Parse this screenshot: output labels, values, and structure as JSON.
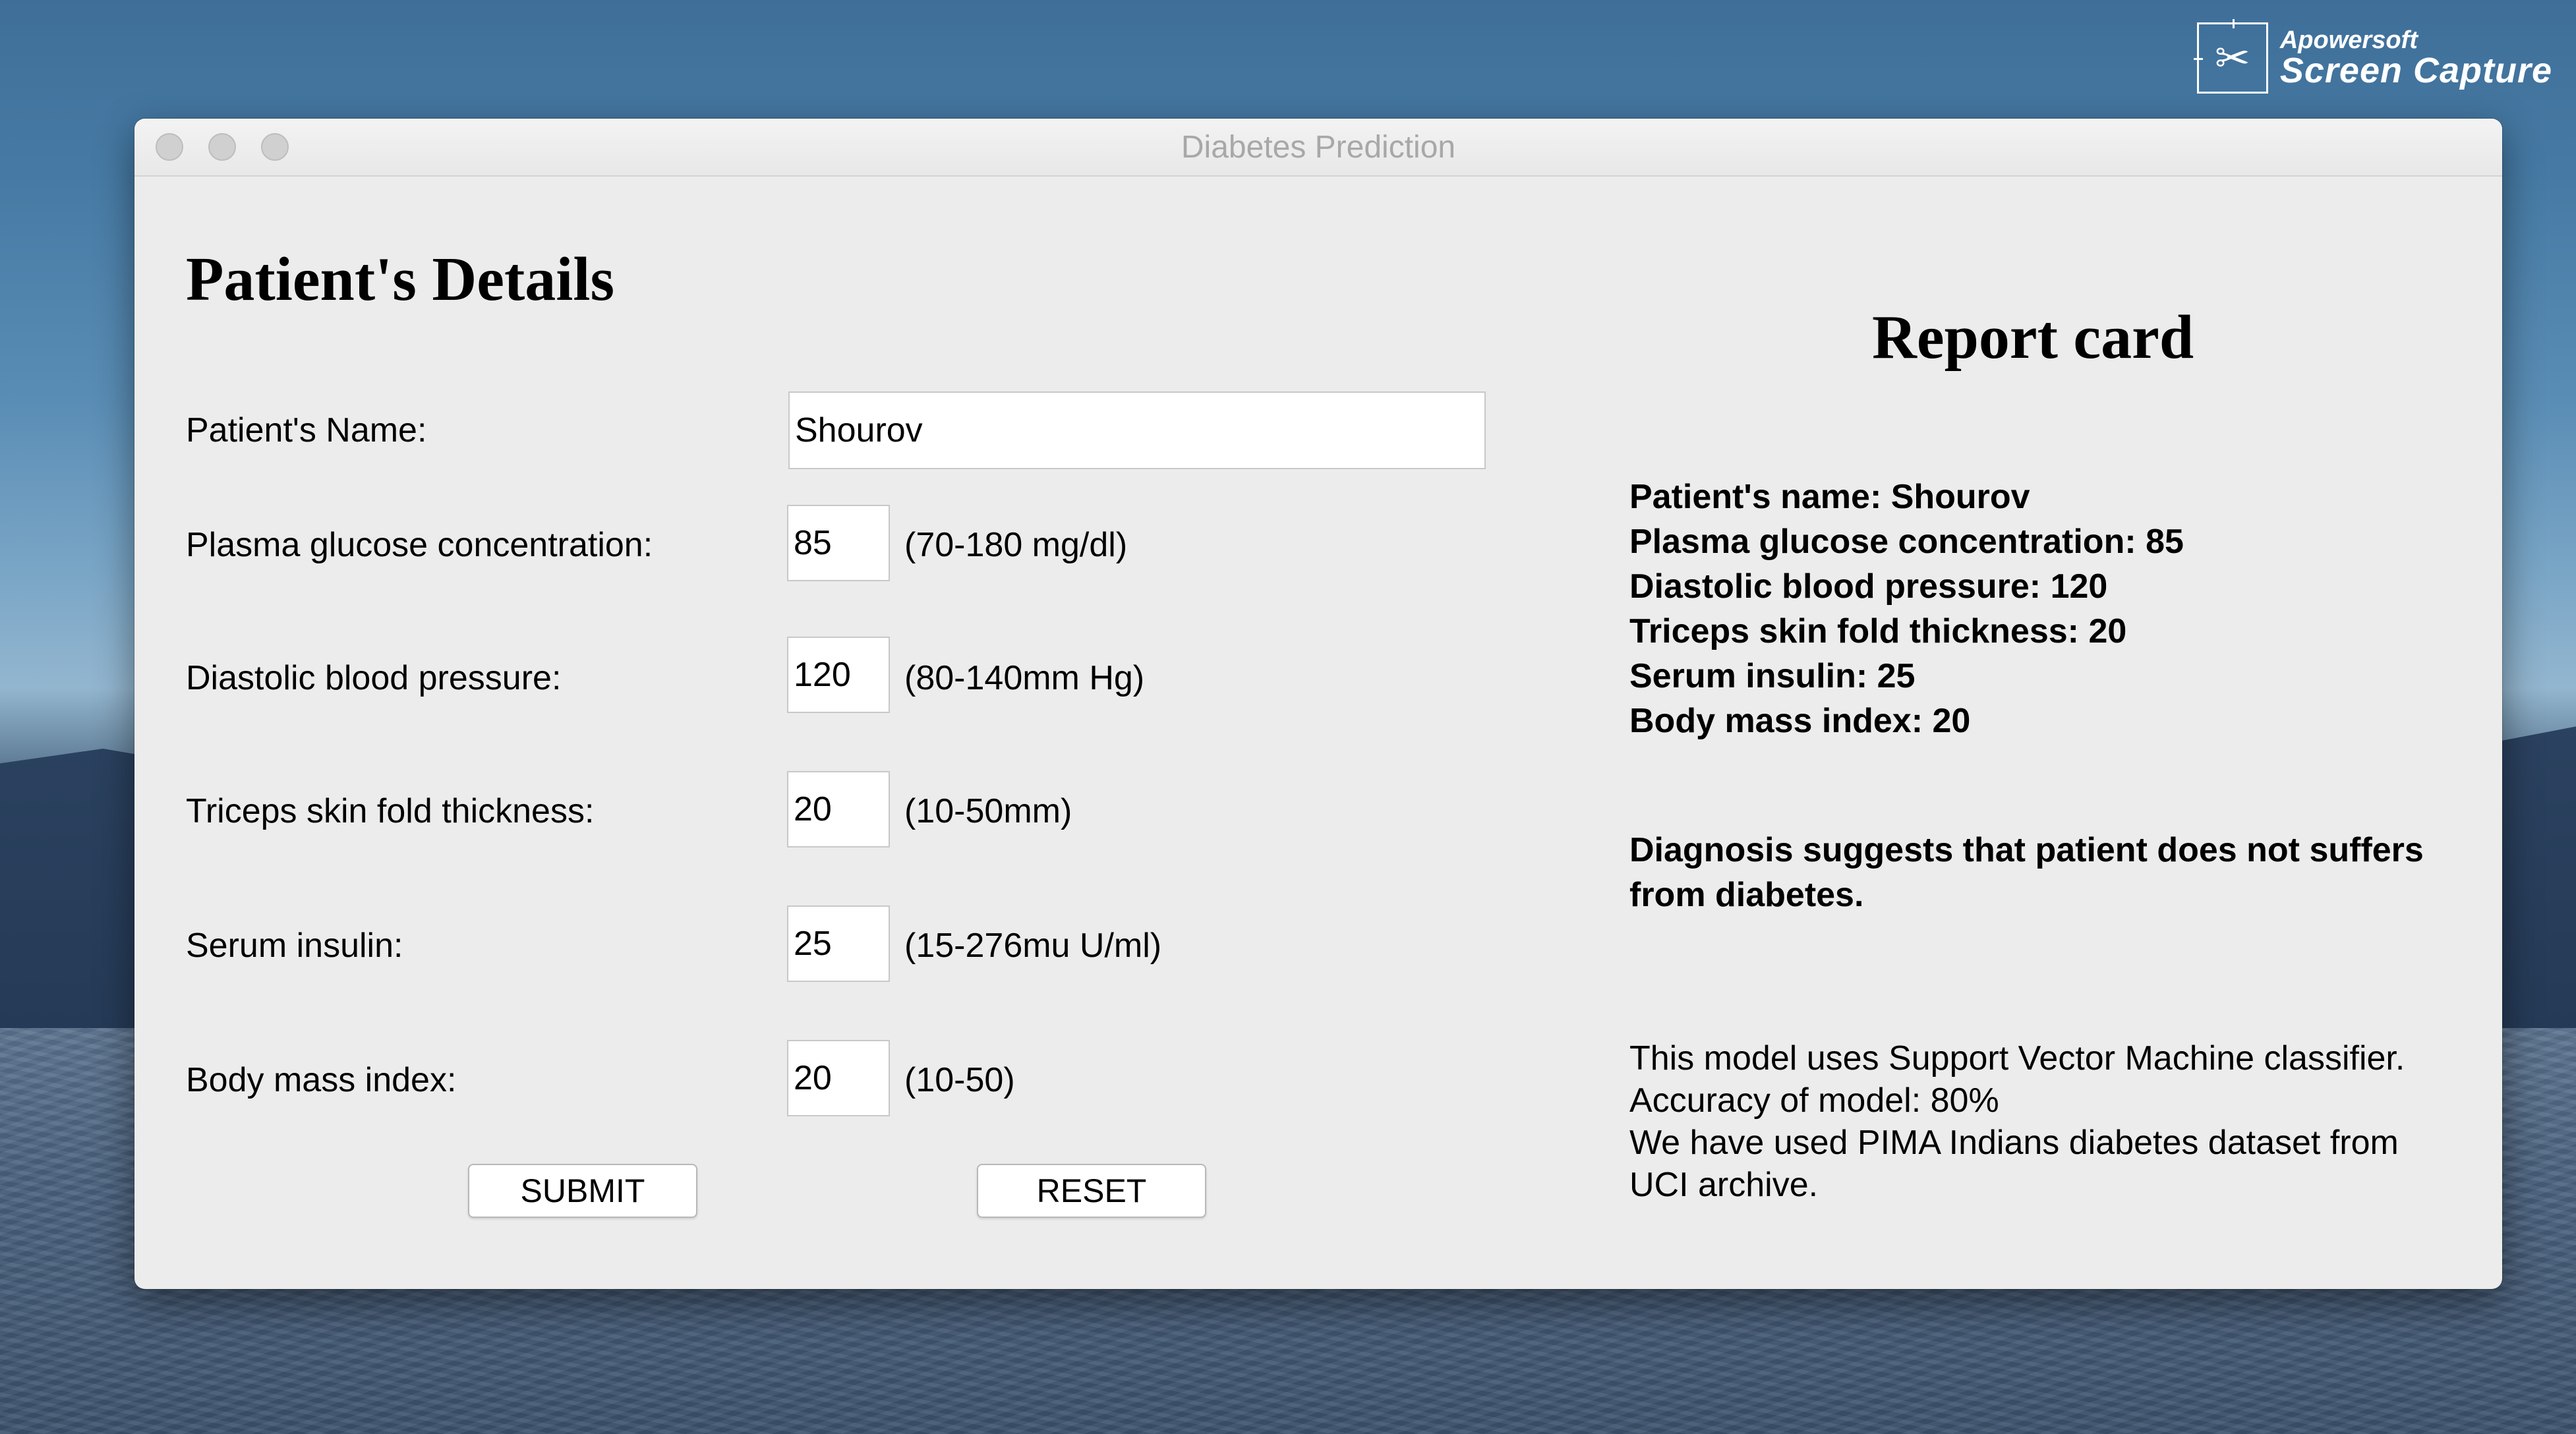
{
  "badge": {
    "line1": "Apowersoft",
    "line2": "Screen Capture",
    "icon": "scissors-pen-icon"
  },
  "window": {
    "title": "Diabetes Prediction"
  },
  "form": {
    "heading": "Patient's Details",
    "name_label": "Patient's Name:",
    "name_value": "Shourov",
    "fields": [
      {
        "label": "Plasma glucose concentration:",
        "value": "85",
        "range": "(70-180 mg/dl)"
      },
      {
        "label": "Diastolic blood pressure:",
        "value": "120",
        "range": "(80-140mm Hg)"
      },
      {
        "label": "Triceps skin fold thickness:",
        "value": "20",
        "range": "(10-50mm)"
      },
      {
        "label": "Serum insulin:",
        "value": "25",
        "range": "(15-276mu U/ml)"
      },
      {
        "label": "Body mass index:",
        "value": "20",
        "range": "(10-50)"
      }
    ],
    "submit_label": "SUBMIT",
    "reset_label": "RESET"
  },
  "report": {
    "heading": "Report card",
    "lines": [
      "Patient's name: Shourov",
      "Plasma glucose concentration: 85",
      "Diastolic blood pressure: 120",
      "Triceps skin fold thickness: 20",
      "Serum insulin: 25",
      "Body mass index: 20"
    ],
    "diagnosis": "Diagnosis suggests that patient does not suffers from diabetes.",
    "model_info": [
      "This model uses Support Vector Machine classifier.",
      "Accuracy of model: 80%",
      "We have used PIMA Indians diabetes dataset from",
      "UCI archive."
    ]
  }
}
